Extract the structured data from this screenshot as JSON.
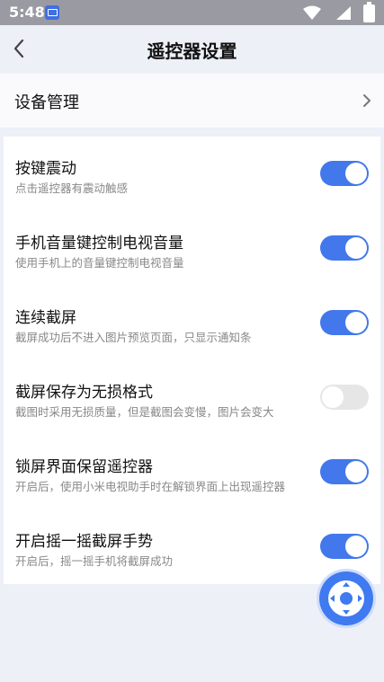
{
  "status_bar": {
    "time": "5:48",
    "icons": [
      "notification-icon",
      "wifi-icon",
      "signal-icon",
      "battery-charging-icon"
    ]
  },
  "header": {
    "title": "遥控器设置",
    "back_icon": "chevron-left-icon"
  },
  "device_management": {
    "label": "设备管理",
    "icon": "chevron-right-icon"
  },
  "settings": [
    {
      "title": "按键震动",
      "description": "点击遥控器有震动触感",
      "enabled": true
    },
    {
      "title": "手机音量键控制电视音量",
      "description": "使用手机上的音量键控制电视音量",
      "enabled": true
    },
    {
      "title": "连续截屏",
      "description": "截屏成功后不进入图片预览页面，只显示通知条",
      "enabled": true
    },
    {
      "title": "截屏保存为无损格式",
      "description": "截图时采用无损质量，但是截图会变慢，图片会变大",
      "enabled": false
    },
    {
      "title": "锁屏界面保留遥控器",
      "description": "开启后，使用小米电视助手时在解锁界面上出现遥控器",
      "enabled": true
    },
    {
      "title": "开启摇一摇截屏手势",
      "description": "开启后，摇一摇手机将截屏成功",
      "enabled": true
    }
  ],
  "floating_button": {
    "icon": "dpad-remote-icon"
  },
  "colors": {
    "accent": "#4278ec",
    "toggle_off": "#e6e6e6",
    "background": "#eef0f8",
    "statusbar": "#9a9aa2"
  }
}
